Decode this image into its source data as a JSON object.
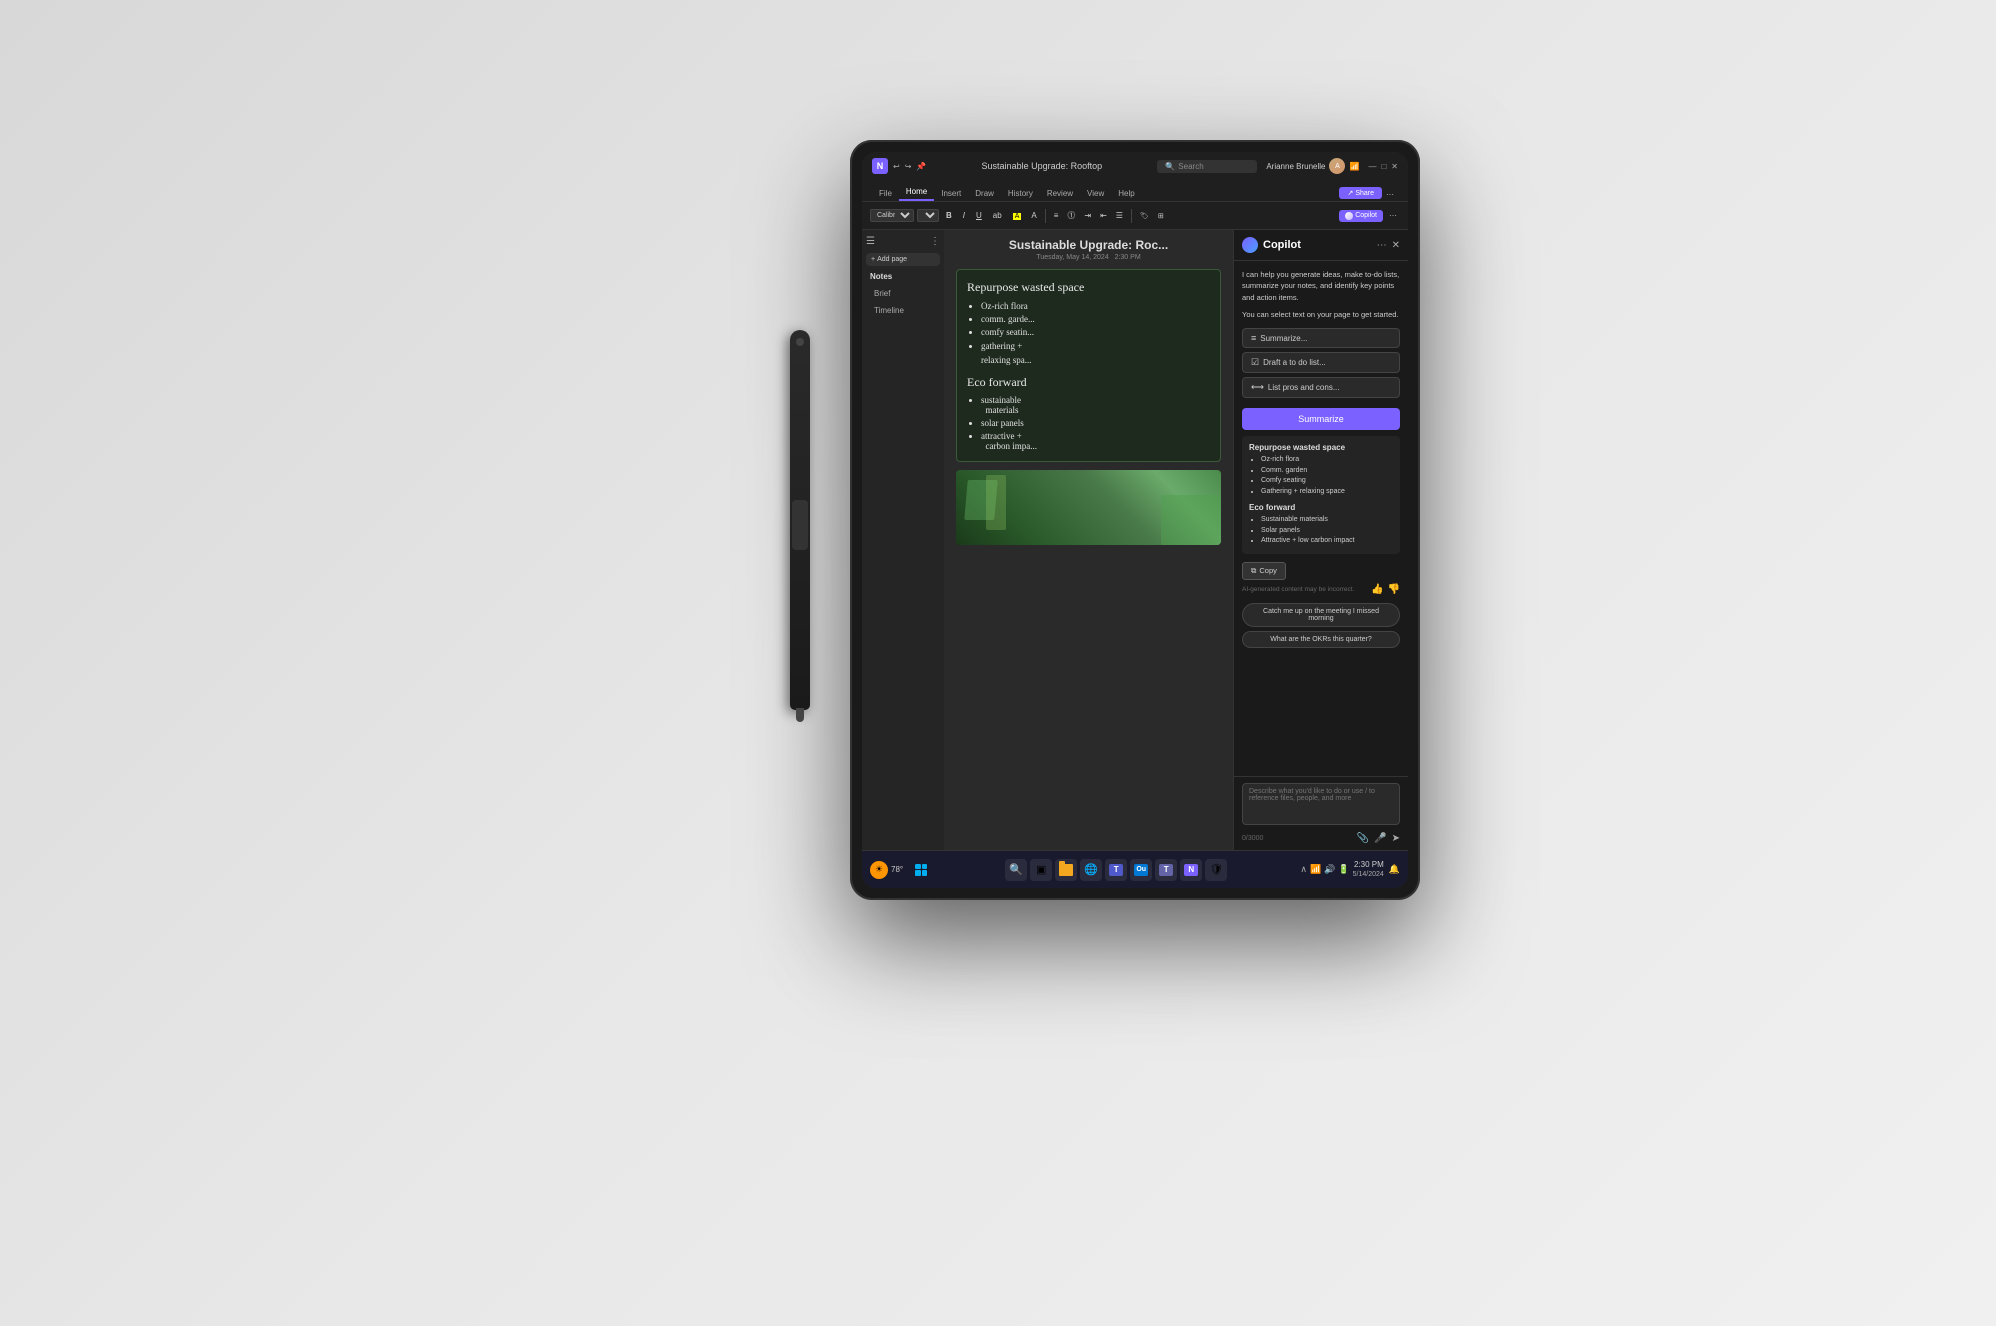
{
  "app": {
    "title": "Sustainable Upgrade: Rooftop",
    "search_placeholder": "Search"
  },
  "titlebar": {
    "app_name": "OneNote",
    "title": "Sustainable Upgrade: Rooftop",
    "user": "Arianne Brunelle",
    "search_label": "Search"
  },
  "ribbon": {
    "tabs": [
      "File",
      "Home",
      "Insert",
      "Draw",
      "History",
      "Review",
      "View",
      "Help"
    ],
    "active_tab": "Home",
    "font": "Calibri",
    "font_size": "11",
    "copilot_label": "Copilot"
  },
  "sidebar": {
    "add_page_label": "Add page",
    "sections": [
      "Notes",
      "Brief",
      "Timeline"
    ]
  },
  "note": {
    "title": "Sustainable Upgrade: Roc...",
    "date": "Tuesday, May 14, 2024",
    "time": "2:30 PM",
    "handwritten_title1": "Repurpose wasted space",
    "handwritten_items1": [
      "Oz-rich flora",
      "comm. garde...",
      "comfy seatin...",
      "gathering + relaxing spa..."
    ],
    "handwritten_title2": "Eco forward",
    "handwritten_items2": [
      "sustainable materials",
      "solar panels",
      "attractive + carbon impa..."
    ]
  },
  "copilot": {
    "title": "Copilot",
    "intro": "I can help you generate ideas, make to-do lists, summarize your notes, and identify key points and action items.",
    "select_hint": "You can select text on your page to get started.",
    "suggestions": [
      {
        "icon": "≡",
        "label": "Summarize..."
      },
      {
        "icon": "☑",
        "label": "Draft a to do list..."
      },
      {
        "icon": "⟷",
        "label": "List pros and cons..."
      }
    ],
    "summarize_btn": "Summarize",
    "summary": {
      "section1_title": "Repurpose wasted space",
      "section1_items": [
        "Oz-rich flora",
        "Comm. garden",
        "Comfy seating",
        "Gathering + relaxing space"
      ],
      "section2_title": "Eco forward",
      "section2_items": [
        "Sustainable materials",
        "Solar panels",
        "Attractive + low carbon impact"
      ]
    },
    "copy_label": "Copy",
    "ai_disclaimer": "AI-generated content may be incorrect.",
    "prompt_chips": [
      "Catch me up on the meeting I missed morning",
      "What are the OKRs this quarter?"
    ],
    "textarea_placeholder": "Describe what you'd like to do or use / to reference files, people, and more",
    "char_count": "0/3000"
  },
  "taskbar": {
    "weather_temp": "78°",
    "weather_icon": "☀",
    "icons": [
      "⊞",
      "⊕",
      "🔍",
      "▣",
      "📁",
      "🌐",
      "🔵",
      "📧",
      "👥",
      "🎵",
      "📓",
      "⚙"
    ],
    "time": "2:30 PM",
    "date": "5/14/2024",
    "history_tab": "History"
  }
}
